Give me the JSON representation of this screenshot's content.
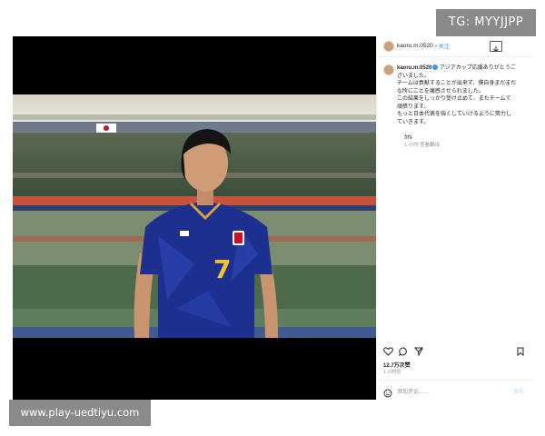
{
  "overlay": {
    "tg_badge": "TG: MYYJJPP",
    "watermark": "www.play-uedtiyu.com"
  },
  "post": {
    "header": {
      "username": "kaoru.m.0520",
      "follow": "• 关注"
    },
    "caption": {
      "username": "kaoru.m.0520",
      "lines": [
        "アジアカップ応援ありがとうご",
        "ざいました。",
        "チームは貢献することが出来ず、僕自身まだまだ",
        "な所にことを痛感させられました。",
        "この結果をしっかり受け止めて、またチームで",
        "頑張ります。",
        "もっと日本代表を強くしていけるように努力し",
        "ていきます。"
      ],
      "signature": "ｶｵﾙ",
      "time": "1 小时  查看翻译"
    },
    "player": {
      "jersey_number": "7"
    },
    "likes": "12.7万次赞",
    "time_ago": "1 小时前",
    "comment": {
      "placeholder": "添加评论……",
      "post_label": "发布"
    },
    "colors": {
      "accent": "#3897f0",
      "jersey": "#1d2f8f",
      "number": "#f2c230"
    },
    "icons": [
      "heart-icon",
      "comment-icon",
      "share-icon",
      "bookmark-icon",
      "emoji-icon",
      "more-icon"
    ]
  }
}
